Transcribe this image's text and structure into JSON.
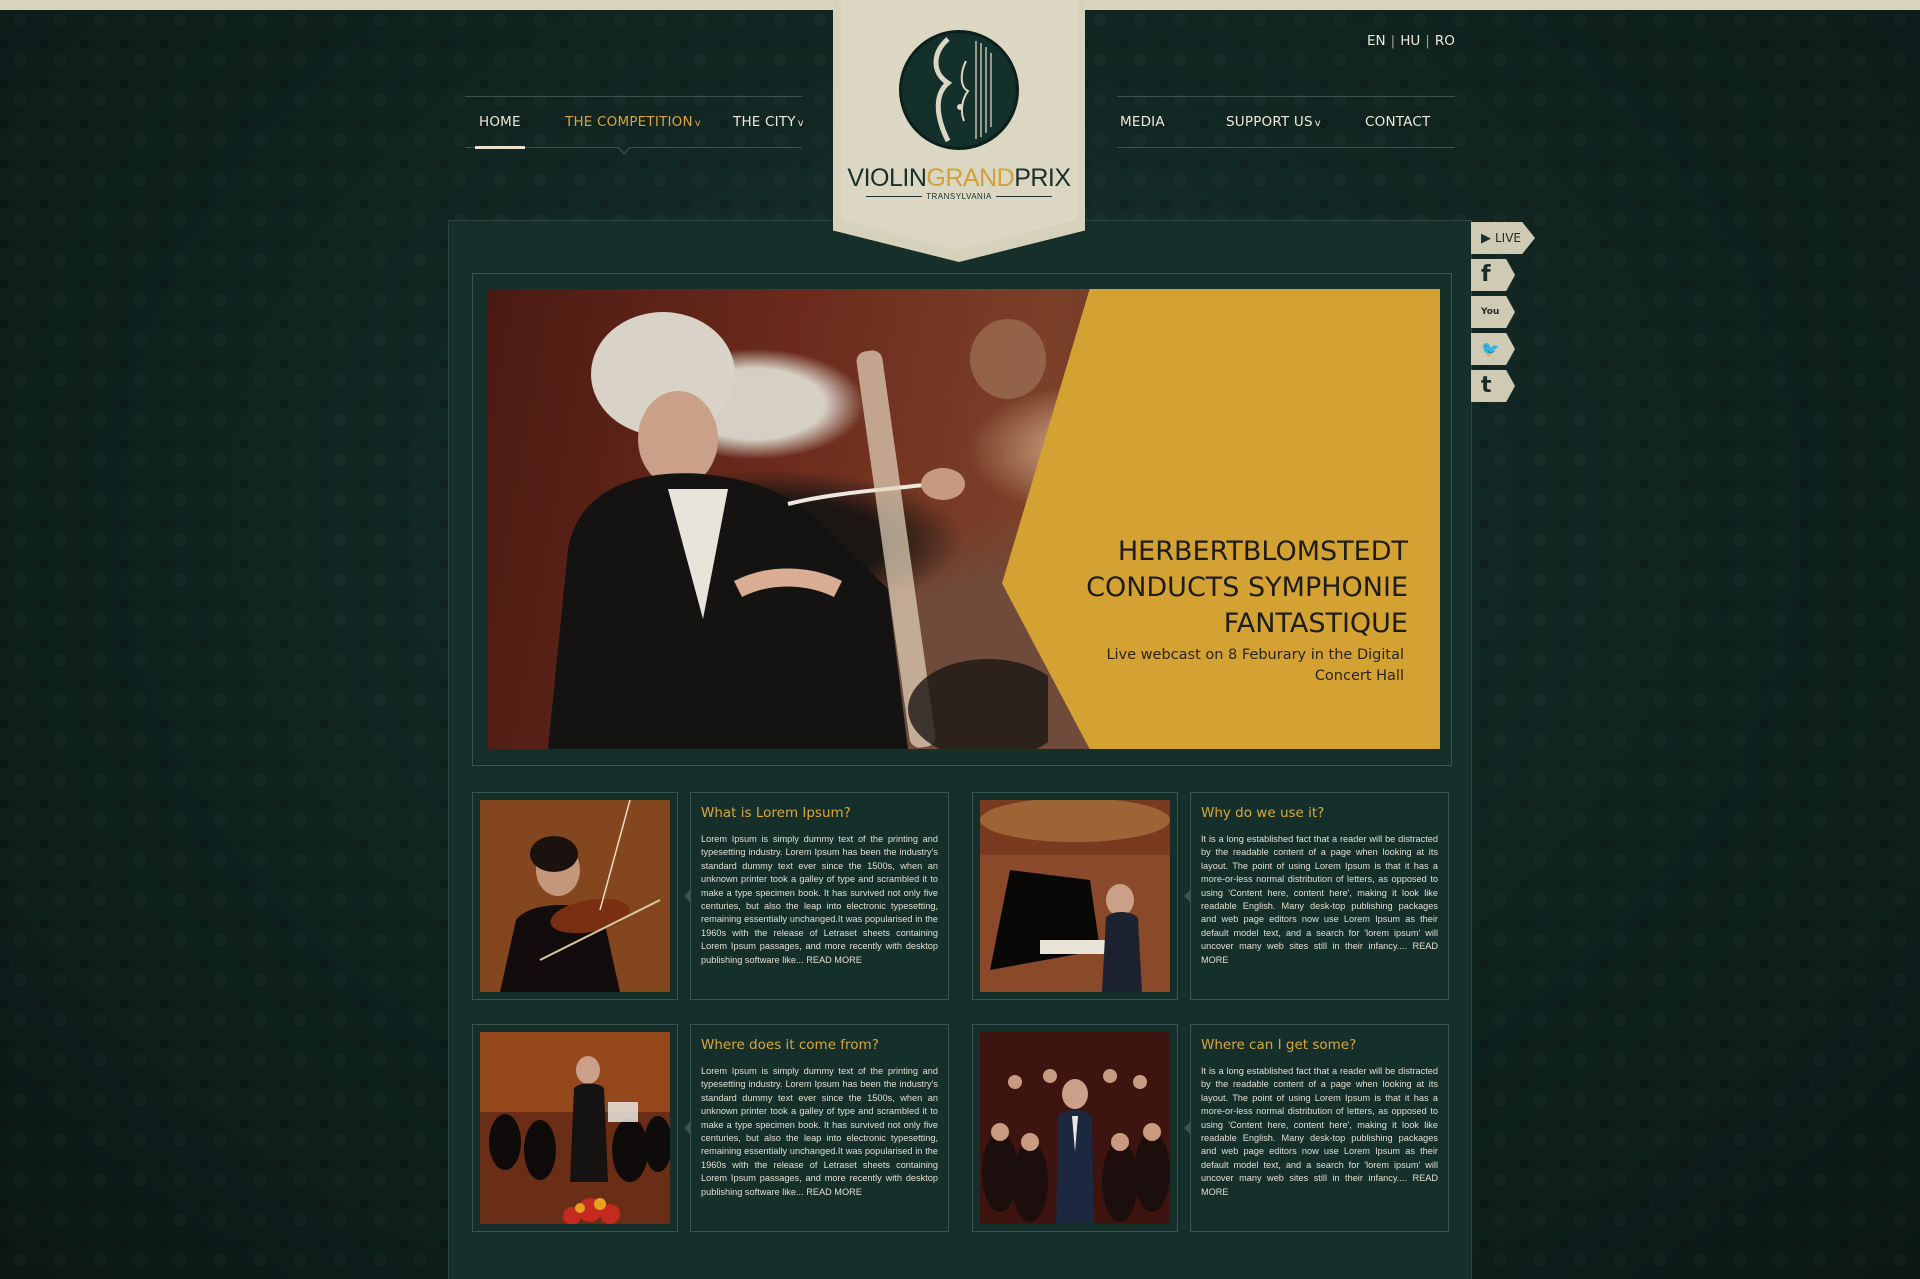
{
  "languages": [
    "EN",
    "HU",
    "RO"
  ],
  "nav_left": [
    {
      "label": "HOME",
      "active": false,
      "dropdown": false
    },
    {
      "label": "THE COMPETITION",
      "active": true,
      "dropdown": true
    },
    {
      "label": "THE CITY",
      "active": false,
      "dropdown": true
    }
  ],
  "nav_right": [
    {
      "label": "MEDIA",
      "dropdown": false
    },
    {
      "label": "SUPPORT US",
      "dropdown": true
    },
    {
      "label": "CONTACT",
      "dropdown": false
    }
  ],
  "dropdown_marker": "v",
  "logo": {
    "part1": "VIOLIN",
    "part2": "GRAND",
    "part3": "PRIX",
    "sub": "TRANSYLVANIA"
  },
  "social": [
    {
      "icon": "play-icon",
      "glyph": "▶",
      "label": "LIVE"
    },
    {
      "icon": "facebook-icon",
      "glyph": "f",
      "label": ""
    },
    {
      "icon": "youtube-icon",
      "glyph": "You",
      "label": ""
    },
    {
      "icon": "twitter-icon",
      "glyph": "🐦",
      "label": ""
    },
    {
      "icon": "tumblr-icon",
      "glyph": "t",
      "label": ""
    }
  ],
  "hero": {
    "title": "HERBERTBLOMSTEDT CONDUCTS SYMPHONIE FANTASTIQUE",
    "subtitle": "Live webcast on 8 Feburary in the Digital Concert Hall"
  },
  "cards": [
    {
      "title": "What is Lorem Ipsum?",
      "body": "Lorem Ipsum is simply dummy text of the printing and typesetting industry. Lorem Ipsum has been the industry's standard dummy text ever since the 1500s, when an unknown printer took a galley of type and scrambled it to make a type specimen book. It has survived not only five centuries, but also the leap into electronic typesetting, remaining essentially unchanged.It was popularised in the 1960s with the release of Letraset sheets containing Lorem Ipsum passages, and more recently with desktop publishing software like...",
      "more": "READ MORE"
    },
    {
      "title": "Why do we use it?",
      "body": "It is a long established fact that a reader will be distracted by the readable content of a page when looking at its layout. The point of using Lorem Ipsum is that it has a more-or-less normal distribution of letters, as opposed to using 'Content here, content here', making it look like readable English. Many desk-top publishing packages and web page editors now use Lorem Ipsum as their default model text, and a search for 'lorem ipsum' will uncover many web sites still in their infancy....",
      "more": "READ MORE"
    },
    {
      "title": "Where does it come from?",
      "body": "Lorem Ipsum is simply dummy text of the printing and typesetting industry. Lorem Ipsum has been the industry's standard dummy text ever since the 1500s, when an unknown printer took a galley of type and scrambled it to make a type specimen book. It has survived not only five centuries, but also the leap into electronic typesetting, remaining essentially unchanged.It was popularised in the 1960s with the release of Letraset sheets containing Lorem Ipsum passages, and more recently with desktop publishing software like...",
      "more": "READ MORE"
    },
    {
      "title": "Where can I get some?",
      "body": "It is a long established fact that a reader will be distracted by the readable content of a page when looking at its layout. The point of using Lorem Ipsum is that it has a more-or-less normal distribution of letters, as opposed to using 'Content here, content here', making it look like readable English. Many desk-top publishing packages and web page editors now use Lorem Ipsum as their default model text, and a search for 'lorem ipsum' will uncover many web sites still in their infancy....",
      "more": "READ MORE"
    }
  ],
  "colors": {
    "accent": "#d3a232",
    "background": "#0f211e",
    "panel": "#15302b",
    "cream": "#d6d1bb"
  }
}
